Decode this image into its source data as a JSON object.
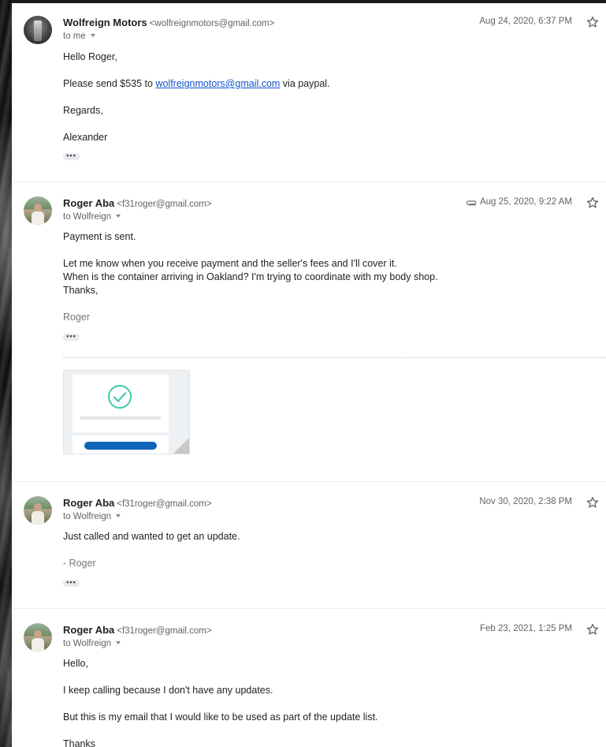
{
  "messages": [
    {
      "sender_name": "Wolfreign Motors",
      "sender_email": "<wolfreignmotors@gmail.com>",
      "recipient": "to me",
      "date": "Aug 24, 2020, 6:37 PM",
      "lines": {
        "greeting": "Hello Roger,",
        "request_prefix": "Please send $535 to ",
        "request_link": "wolfreignmotors@gmail.com",
        "request_suffix": " via paypal.",
        "regards": "Regards,",
        "signature": "Alexander"
      },
      "more_label": "•••"
    },
    {
      "sender_name": "Roger Aba",
      "sender_email": "<f31roger@gmail.com>",
      "recipient": "to Wolfreign",
      "date": "Aug 25, 2020, 9:22 AM",
      "has_attachment": true,
      "lines": {
        "line1": "Payment is sent.",
        "line2": "Let me know when you receive payment and the seller's fees and I'll cover it.",
        "line3": "When is the container arriving in Oakland? I'm trying to coordinate with my body shop.",
        "line4": "Thanks,",
        "signature": "Roger"
      },
      "more_label": "•••"
    },
    {
      "sender_name": "Roger Aba",
      "sender_email": "<f31roger@gmail.com>",
      "recipient": "to Wolfreign",
      "date": "Nov 30, 2020, 2:38 PM",
      "lines": {
        "line1": "Just called and wanted to get an update.",
        "signature": "- Roger"
      },
      "more_label": "•••"
    },
    {
      "sender_name": "Roger Aba",
      "sender_email": "<f31roger@gmail.com>",
      "recipient": "to Wolfreign",
      "date": "Feb 23, 2021, 1:25 PM",
      "lines": {
        "line1": "Hello,",
        "line2": "I keep calling because I don't have any updates.",
        "line3": "But this is my email that I would like to be used as part of the update list.",
        "line4": "Thanks"
      }
    }
  ],
  "icons": {
    "star": "star-icon",
    "attachment": "paperclip-icon",
    "expand": "caret-down-icon",
    "check": "check-circle-icon"
  },
  "colors": {
    "link": "#1155cc",
    "check_accent": "#3ec9a7",
    "attachment_button": "#0f63b8"
  }
}
